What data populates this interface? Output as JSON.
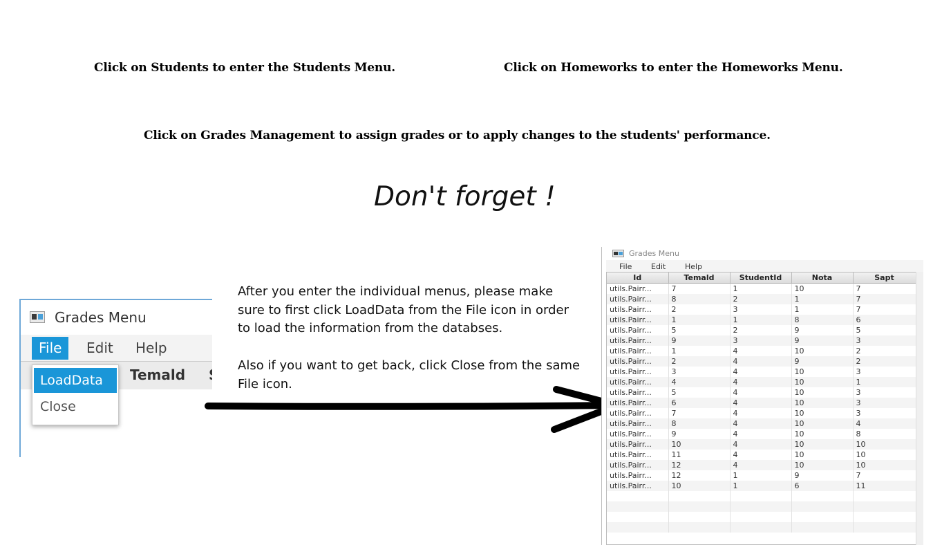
{
  "headings": {
    "students": "Click on Students to enter the Students Menu.",
    "homeworks": "Click on Homeworks to enter the Homeworks Menu.",
    "grades": "Click on Grades Management to assign grades or to apply changes to the students' performance."
  },
  "reminder": "Don't forget !",
  "instructions": {
    "para1": "After you enter the individual menus, please make sure to first click LoadData from the File icon in order to load the information from the databses.",
    "para2": "Also if you want to get back, click Close from the same File icon."
  },
  "zoom": {
    "window_title": "Grades Menu",
    "menus": [
      "File",
      "Edit",
      "Help"
    ],
    "header_visible": "Temald",
    "header_cut": "S",
    "file_menu_items": [
      "LoadData",
      "Close"
    ]
  },
  "window": {
    "title": "Grades Menu",
    "menus": [
      "File",
      "Edit",
      "Help"
    ],
    "columns": [
      "Id",
      "Temald",
      "StudentId",
      "Nota",
      "Sapt"
    ],
    "rows": [
      [
        "utils.Pairr...",
        "7",
        "1",
        "10",
        "7"
      ],
      [
        "utils.Pairr...",
        "8",
        "2",
        "1",
        "7"
      ],
      [
        "utils.Pairr...",
        "2",
        "3",
        "1",
        "7"
      ],
      [
        "utils.Pairr...",
        "1",
        "1",
        "8",
        "6"
      ],
      [
        "utils.Pairr...",
        "5",
        "2",
        "9",
        "5"
      ],
      [
        "utils.Pairr...",
        "9",
        "3",
        "9",
        "3"
      ],
      [
        "utils.Pairr...",
        "1",
        "4",
        "10",
        "2"
      ],
      [
        "utils.Pairr...",
        "2",
        "4",
        "9",
        "2"
      ],
      [
        "utils.Pairr...",
        "3",
        "4",
        "10",
        "3"
      ],
      [
        "utils.Pairr...",
        "4",
        "4",
        "10",
        "1"
      ],
      [
        "utils.Pairr...",
        "5",
        "4",
        "10",
        "3"
      ],
      [
        "utils.Pairr...",
        "6",
        "4",
        "10",
        "3"
      ],
      [
        "utils.Pairr...",
        "7",
        "4",
        "10",
        "3"
      ],
      [
        "utils.Pairr...",
        "8",
        "4",
        "10",
        "4"
      ],
      [
        "utils.Pairr...",
        "9",
        "4",
        "10",
        "8"
      ],
      [
        "utils.Pairr...",
        "10",
        "4",
        "10",
        "10"
      ],
      [
        "utils.Pairr...",
        "11",
        "4",
        "10",
        "10"
      ],
      [
        "utils.Pairr...",
        "12",
        "4",
        "10",
        "10"
      ],
      [
        "utils.Pairr...",
        "12",
        "1",
        "9",
        "7"
      ],
      [
        "utils.Pairr...",
        "10",
        "1",
        "6",
        "11"
      ]
    ]
  },
  "colors": {
    "menu_highlight": "#1a96d8",
    "window_border": "#6ea8d8",
    "arrow": "#000000"
  }
}
